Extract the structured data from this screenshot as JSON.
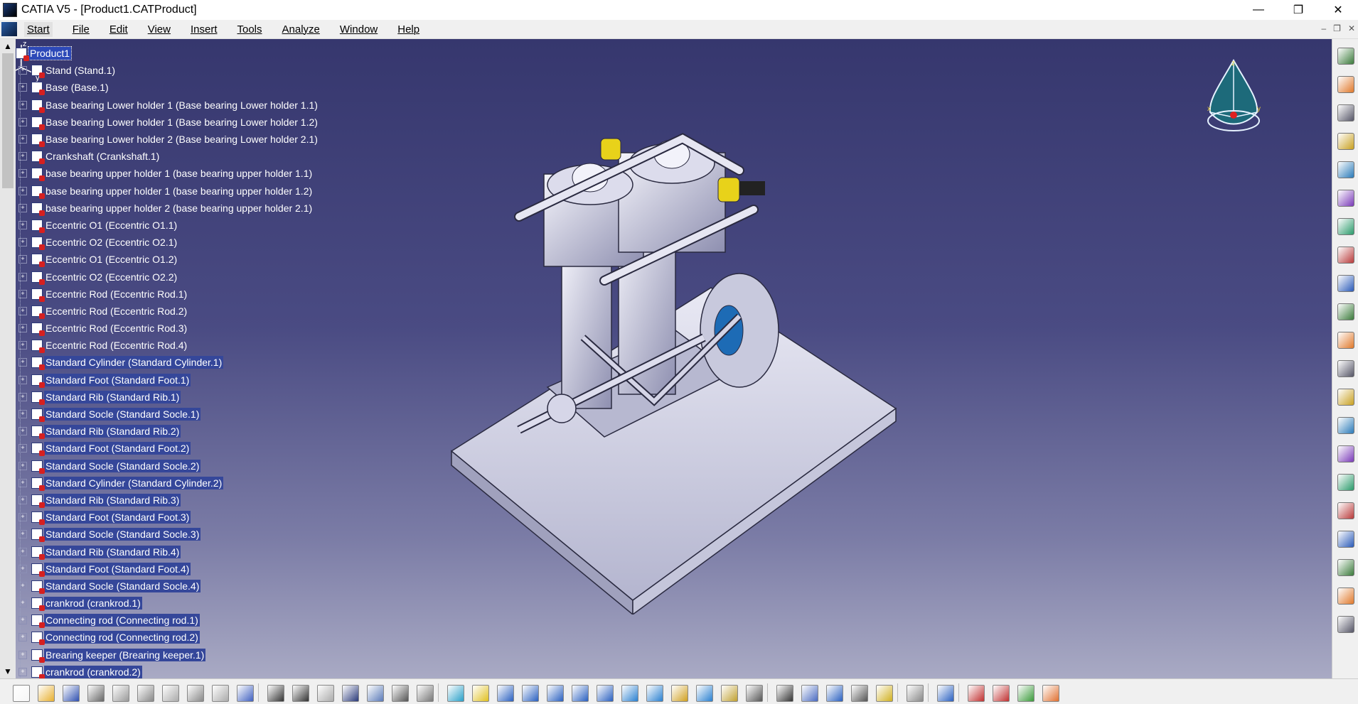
{
  "window": {
    "title": "CATIA V5 - [Product1.CATProduct]",
    "minimize_glyph": "—",
    "restore_glyph": "❐",
    "close_glyph": "✕"
  },
  "menu": {
    "items": [
      "Start",
      "File",
      "Edit",
      "View",
      "Insert",
      "Tools",
      "Analyze",
      "Window",
      "Help"
    ]
  },
  "doc_controls": {
    "minimize": "–",
    "restore": "❐",
    "close": "✕"
  },
  "tree": {
    "root": "Product1",
    "nodes": [
      "Stand (Stand.1)",
      "Base (Base.1)",
      "Base bearing Lower holder 1 (Base bearing Lower holder 1.1)",
      "Base bearing Lower holder 1 (Base bearing Lower holder 1.2)",
      "Base bearing Lower holder 2 (Base bearing Lower holder 2.1)",
      "Crankshaft (Crankshaft.1)",
      "base bearing upper holder 1 (base bearing upper holder 1.1)",
      "base bearing upper holder 1 (base bearing upper holder 1.2)",
      "base bearing upper holder 2 (base bearing upper holder 2.1)",
      "Eccentric O1 (Eccentric O1.1)",
      "Eccentric O2 (Eccentric O2.1)",
      "Eccentric O1 (Eccentric O1.2)",
      "Eccentric O2 (Eccentric O2.2)",
      "Eccentric Rod (Eccentric Rod.1)",
      "Eccentric Rod (Eccentric Rod.2)",
      "Eccentric Rod (Eccentric Rod.3)",
      "Eccentric Rod (Eccentric Rod.4)",
      "Standard Cylinder (Standard Cylinder.1)",
      "Standard Foot (Standard Foot.1)",
      "Standard Rib (Standard Rib.1)",
      "Standard Socle (Standard Socle.1)",
      "Standard Rib (Standard Rib.2)",
      "Standard Foot (Standard Foot.2)",
      "Standard Socle (Standard Socle.2)",
      "Standard Cylinder (Standard Cylinder.2)",
      "Standard Rib (Standard Rib.3)",
      "Standard Foot (Standard Foot.3)",
      "Standard Socle (Standard Socle.3)",
      "Standard Rib (Standard Rib.4)",
      "Standard Foot (Standard Foot.4)",
      "Standard Socle (Standard Socle.4)",
      "crankrod (crankrod.1)",
      "Connecting rod (Connecting rod.1)",
      "Connecting rod (Connecting rod.2)",
      "Brearing keeper (Brearing keeper.1)",
      "crankrod (crankrod.2)"
    ]
  },
  "compass": {
    "x_label": "x",
    "y_label": "y",
    "z_label": "z"
  },
  "axis_triad": {
    "x_label": "x",
    "y_label": "y",
    "z_label": "z"
  },
  "colors": {
    "viewport_top": "#36376e",
    "viewport_bottom": "#a9aac4",
    "selection": "#35479a",
    "compass_fill": "#1d6a7a"
  },
  "right_toolbar_icons": [
    "assembly-gear-icon",
    "select-cursor-icon",
    "manipulate-icon",
    "gear-1-icon",
    "gear-2-icon",
    "gear-3-icon",
    "insert-component-icon",
    "insert-part-icon",
    "replace-icon",
    "constraint-icon",
    "catalog-icon",
    "product-icon",
    "move-icon",
    "explode-icon",
    "snap-icon",
    "clash-icon",
    "section-icon",
    "measure-icon",
    "bom-icon",
    "publish-icon",
    "scenes-icon"
  ],
  "bottom_toolbar_icons": [
    "new-icon",
    "open-icon",
    "save-icon",
    "print-icon",
    "cut-icon",
    "copy-icon",
    "paste-icon",
    "undo-icon",
    "redo-icon",
    "whats-this-icon",
    "formula-icon",
    "knowledge-icon",
    "design-table-icon",
    "table-icon",
    "law-icon",
    "parameter-icon",
    "analysis-icon",
    "fly-mode-icon",
    "fit-all-icon",
    "pan-icon",
    "rotate-icon",
    "zoom-in-icon",
    "zoom-out-icon",
    "normal-view-icon",
    "multi-view-icon",
    "iso-view-icon",
    "hide-show-icon",
    "shading-icon",
    "material-icon",
    "axis-system-icon",
    "capture-icon",
    "catalog-browser-icon",
    "measure-between-icon",
    "measure-item-icon",
    "measure-inertia-icon",
    "update-icon",
    "apply-material-icon",
    "render-icon",
    "cube-render-icon",
    "multi-render-icon",
    "grid-icon"
  ]
}
